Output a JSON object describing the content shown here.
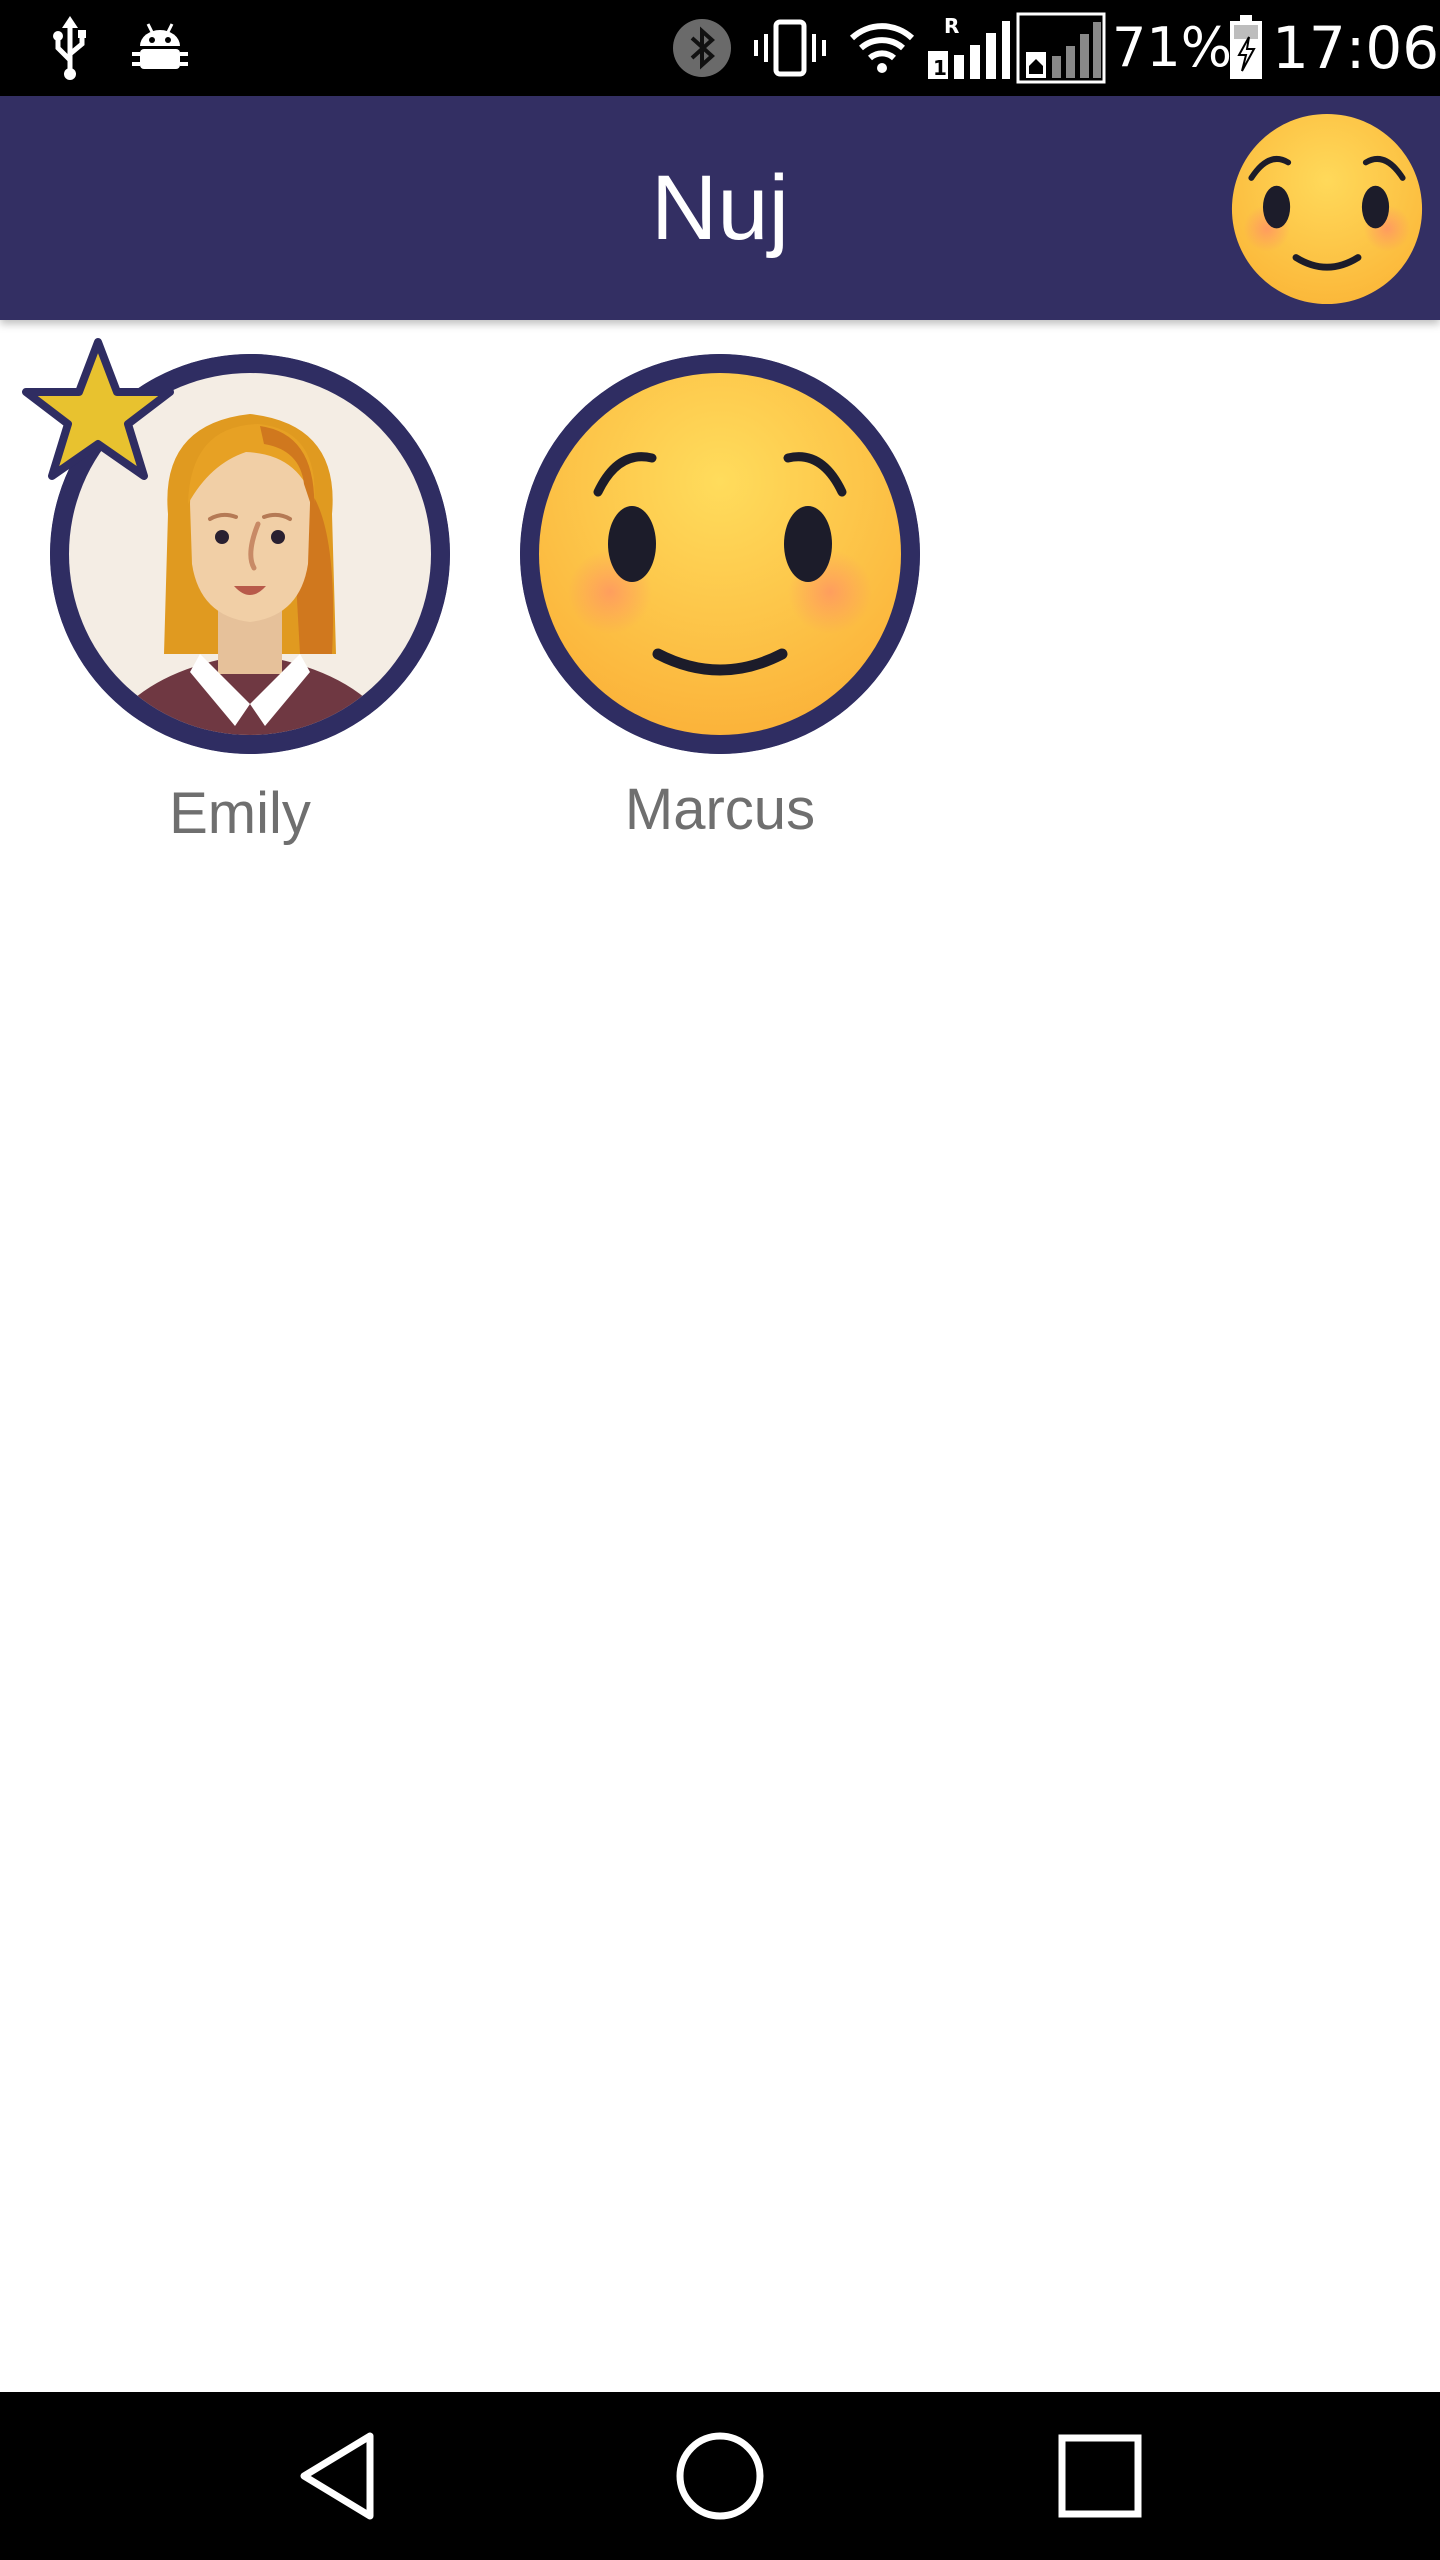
{
  "status_bar": {
    "battery_percent": "71%",
    "time": "17:06",
    "roaming_indicator": "R",
    "icons": [
      "usb-icon",
      "android-debug-icon",
      "bluetooth-icon",
      "vibrate-icon",
      "wifi-icon",
      "signal-sim1-icon",
      "signal-sim2-icon",
      "battery-charging-icon"
    ]
  },
  "app_bar": {
    "title": "Nuj",
    "profile_icon": "smiley-face-icon"
  },
  "contacts": [
    {
      "name": "Emily",
      "avatar": "woman-portrait-icon",
      "favorite": true
    },
    {
      "name": "Marcus",
      "avatar": "smiley-face-icon",
      "favorite": false
    }
  ],
  "nav_bar": {
    "icons": [
      "back-icon",
      "home-icon",
      "recent-apps-icon"
    ]
  },
  "colors": {
    "app_bar": "#332f63",
    "avatar_ring": "#2f2d62",
    "star": "#e8c22f",
    "name_text": "#6f6f6f"
  }
}
